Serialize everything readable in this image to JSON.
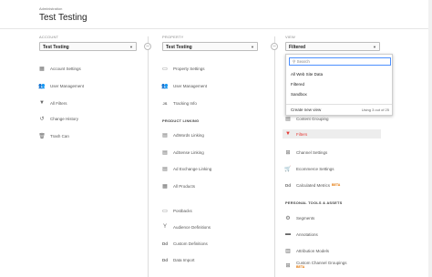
{
  "header": {
    "breadcrumb": "Administration",
    "title": "Test Testing"
  },
  "account": {
    "heading": "ACCOUNT",
    "selected": "Test Testing",
    "items": [
      {
        "label": "Account Settings",
        "icon": "building-icon"
      },
      {
        "label": "User Management",
        "icon": "users-icon"
      },
      {
        "label": "All Filters",
        "icon": "filter-icon"
      },
      {
        "label": "Change History",
        "icon": "history-icon"
      },
      {
        "label": "Trash Can",
        "icon": "trash-icon"
      }
    ]
  },
  "property": {
    "heading": "PROPERTY",
    "selected": "Test Testing",
    "items": [
      {
        "label": "Property Settings",
        "icon": "settings-icon"
      },
      {
        "label": "User Management",
        "icon": "users-icon"
      },
      {
        "label": "Tracking Info",
        "icon": "js-icon"
      }
    ],
    "section_product_linking": "PRODUCT LINKING",
    "linking_items": [
      {
        "label": "AdWords Linking",
        "icon": "adwords-icon"
      },
      {
        "label": "AdSense Linking",
        "icon": "adsense-icon"
      },
      {
        "label": "Ad Exchange Linking",
        "icon": "adexchange-icon"
      },
      {
        "label": "All Products",
        "icon": "products-icon"
      }
    ],
    "more_items": [
      {
        "label": "Postbacks",
        "icon": "postbacks-icon"
      },
      {
        "label": "Audience Definitions",
        "icon": "audience-icon"
      },
      {
        "label": "Custom Definitions",
        "icon": "dd-icon"
      },
      {
        "label": "Data Import",
        "icon": "data-import-icon"
      }
    ]
  },
  "view": {
    "heading": "VIEW",
    "selected": "Filtered",
    "dropdown": {
      "search_placeholder": "Search",
      "options": [
        "All Web Site Data",
        "Filtered",
        "Sandbox"
      ],
      "create_new": "Create new view",
      "usage": "Using 3 out of 25"
    },
    "items": [
      {
        "label": "Content Grouping",
        "icon": "grouping-icon"
      },
      {
        "label": "Filters",
        "icon": "filter-icon",
        "active": true
      },
      {
        "label": "Channel Settings",
        "icon": "channel-icon"
      },
      {
        "label": "Ecommerce Settings",
        "icon": "cart-icon"
      },
      {
        "label": "Calculated Metrics",
        "icon": "dd-icon",
        "badge": "BETA"
      }
    ],
    "section_personal": "PERSONAL TOOLS & ASSETS",
    "personal_items": [
      {
        "label": "Segments",
        "icon": "segments-icon"
      },
      {
        "label": "Annotations",
        "icon": "annotations-icon"
      },
      {
        "label": "Attribution Models",
        "icon": "attribution-icon"
      },
      {
        "label": "Custom Channel Groupings",
        "icon": "channel-grouping-icon",
        "badge": "BETA"
      }
    ]
  },
  "colors": {
    "accent_red": "#e53935",
    "beta_orange": "#e37400",
    "focus_blue": "#4d90fe"
  }
}
